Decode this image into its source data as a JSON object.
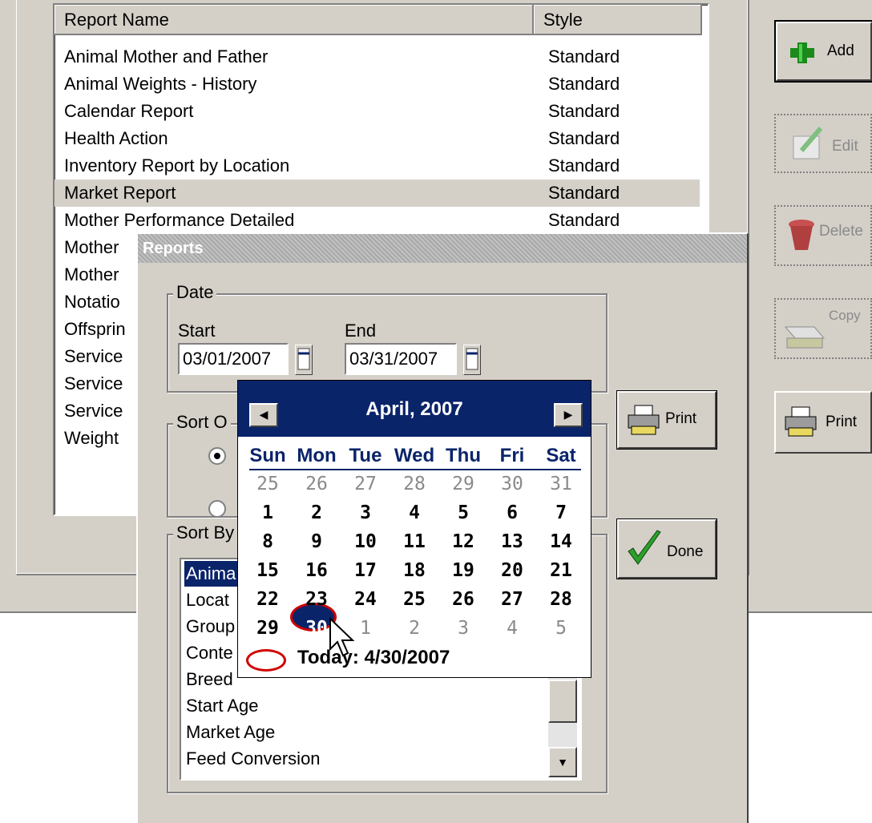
{
  "report_list": {
    "columns": [
      "Report Name",
      "Style"
    ],
    "rows": [
      {
        "name": "Animal Mother and Father",
        "style": "Standard"
      },
      {
        "name": "Animal Weights - History",
        "style": "Standard"
      },
      {
        "name": "Calendar Report",
        "style": "Standard"
      },
      {
        "name": "Health Action",
        "style": "Standard"
      },
      {
        "name": "Inventory Report by Location",
        "style": "Standard"
      },
      {
        "name": "Market Report",
        "style": "Standard"
      },
      {
        "name": "Mother Performance Detailed",
        "style": "Standard"
      },
      {
        "name": "Mother",
        "style": ""
      },
      {
        "name": "Mother",
        "style": ""
      },
      {
        "name": "Notatio",
        "style": ""
      },
      {
        "name": "Offsprin",
        "style": ""
      },
      {
        "name": "Service",
        "style": ""
      },
      {
        "name": "Service",
        "style": ""
      },
      {
        "name": "Service",
        "style": ""
      },
      {
        "name": "Weight",
        "style": ""
      }
    ]
  },
  "side_buttons": {
    "add": "Add",
    "edit": "Edit",
    "delete": "Delete",
    "copy": "Copy",
    "print": "Print"
  },
  "dialog": {
    "title": "Reports",
    "date_group": "Date",
    "start_label": "Start",
    "end_label": "End",
    "start_value": "03/01/2007",
    "end_value": "03/31/2007",
    "sort_order_group": "Sort O",
    "sort_by_group": "Sort By",
    "sort_by_items": [
      "Anima",
      "Locat",
      "Group",
      "Conte",
      "Breed",
      "Start Age",
      "Market Age",
      "Feed Conversion"
    ],
    "print_label": "Print",
    "done_label": "Done"
  },
  "calendar": {
    "month_title": "April, 2007",
    "weekdays": [
      "Sun",
      "Mon",
      "Tue",
      "Wed",
      "Thu",
      "Fri",
      "Sat"
    ],
    "weeks": [
      [
        "25",
        "26",
        "27",
        "28",
        "29",
        "30",
        "31"
      ],
      [
        "1",
        "2",
        "3",
        "4",
        "5",
        "6",
        "7"
      ],
      [
        "8",
        "9",
        "10",
        "11",
        "12",
        "13",
        "14"
      ],
      [
        "15",
        "16",
        "17",
        "18",
        "19",
        "20",
        "21"
      ],
      [
        "22",
        "23",
        "24",
        "25",
        "26",
        "27",
        "28"
      ],
      [
        "29",
        "30",
        "1",
        "2",
        "3",
        "4",
        "5"
      ]
    ],
    "selected_day": "30",
    "today_text": "Today: 4/30/2007"
  },
  "colors": {
    "face": "#d4d0c8",
    "selection": "#0a246a",
    "annotation": "#d00000"
  }
}
